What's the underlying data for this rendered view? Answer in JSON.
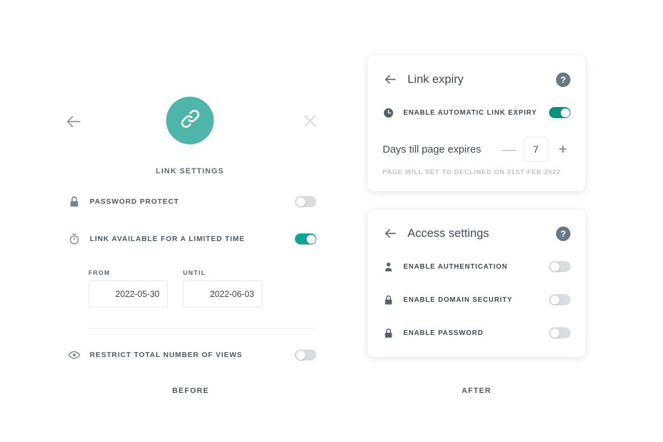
{
  "theme": {
    "accent_teal": "#4fb5ab",
    "toggle_on": "#0a8e80",
    "toggle_off": "#d7dce0",
    "text_dark": "#3c4a59",
    "text_muted": "#bcc3ca",
    "background": "#ffffff"
  },
  "before": {
    "caption": "BEFORE",
    "back_icon": "arrow-left-icon",
    "close_icon": "close-icon",
    "badge_icon": "link-icon",
    "title": "LINK SETTINGS",
    "rows": [
      {
        "icon": "lock-icon",
        "label": "PASSWORD PROTECT",
        "toggle": "off"
      },
      {
        "icon": "stopwatch-icon",
        "label": "LINK AVAILABLE FOR A LIMITED TIME",
        "toggle": "on"
      }
    ],
    "date_from": {
      "label": "FROM",
      "value": "2022-05-30"
    },
    "date_until": {
      "label": "UNTIL",
      "value": "2022-06-03"
    },
    "restrict_row": {
      "icon": "eye-icon",
      "label": "RESTRICT TOTAL NUMBER OF VIEWS",
      "toggle": "off"
    }
  },
  "after": {
    "caption": "AFTER",
    "link_expiry_card": {
      "back_icon": "arrow-left-icon",
      "title": "Link expiry",
      "help_icon": "help-circle-icon",
      "toggle_row": {
        "icon": "clock-icon",
        "label": "ENABLE AUTOMATIC LINK EXPIRY",
        "toggle": "on"
      },
      "stepper": {
        "label": "Days till page expires",
        "minus": "—",
        "value": "7",
        "plus": "+"
      },
      "helper_text": "PAGE WILL SET TO DECLINED ON 21ST FEB 2022"
    },
    "access_settings_card": {
      "back_icon": "arrow-left-icon",
      "title": "Access settings",
      "help_icon": "help-circle-icon",
      "rows": [
        {
          "icon": "person-icon",
          "label": "ENABLE AUTHENTICATION",
          "toggle": "off"
        },
        {
          "icon": "lock-icon",
          "label": "ENABLE DOMAIN SECURITY",
          "toggle": "off"
        },
        {
          "icon": "lock-icon",
          "label": "ENABLE PASSWORD",
          "toggle": "off"
        }
      ]
    }
  }
}
